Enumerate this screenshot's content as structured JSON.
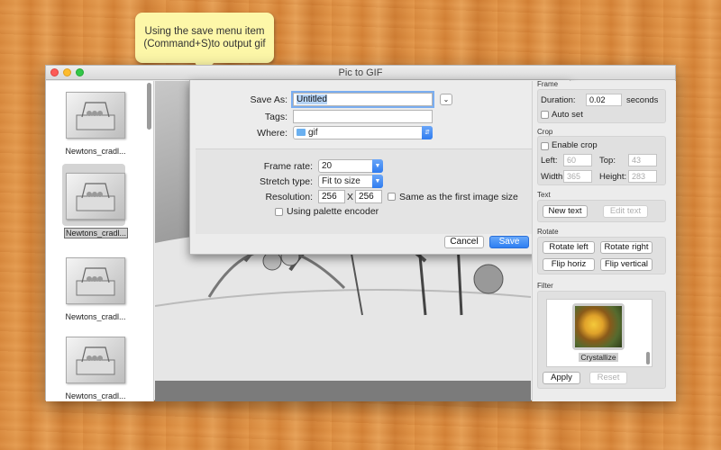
{
  "callout": {
    "line1": "Using the save menu item",
    "line2": "(Command+S)to output gif"
  },
  "window": {
    "title": "Pic to GIF"
  },
  "thumbnails": [
    {
      "label": "Newtons_cradl..."
    },
    {
      "label": "Newtons_cradl...",
      "selected": true
    },
    {
      "label": "Newtons_cradl..."
    },
    {
      "label": "Newtons_cradl..."
    }
  ],
  "save_sheet": {
    "save_as_label": "Save As:",
    "save_as_value": "Untitled",
    "tags_label": "Tags:",
    "tags_value": "",
    "where_label": "Where:",
    "where_value": "gif",
    "frame_rate_label": "Frame rate:",
    "frame_rate_value": "20",
    "stretch_label": "Stretch type:",
    "stretch_value": "Fit to size",
    "resolution_label": "Resolution:",
    "res_width": "256",
    "res_x": "X",
    "res_height": "256",
    "same_size_label": "Same as the first image size",
    "palette_label": "Using palette encoder",
    "cancel_label": "Cancel",
    "save_label": "Save"
  },
  "panel": {
    "frame": {
      "title": "Frame",
      "duration_label": "Duration:",
      "duration_value": "0.02",
      "seconds_label": "seconds",
      "autoset_label": "Auto set"
    },
    "crop": {
      "title": "Crop",
      "enable_label": "Enable crop",
      "left_label": "Left:",
      "left_value": "60",
      "top_label": "Top:",
      "top_value": "43",
      "width_label": "Width:",
      "width_value": "365",
      "height_label": "Height:",
      "height_value": "283"
    },
    "text": {
      "title": "Text",
      "new_label": "New text",
      "edit_label": "Edit text"
    },
    "rotate": {
      "title": "Rotate",
      "rotate_left": "Rotate left",
      "rotate_right": "Rotate right",
      "flip_horiz": "Flip horiz",
      "flip_vertical": "Flip vertical"
    },
    "filter": {
      "title": "Filter",
      "selected_filter": "Crystallize",
      "apply_label": "Apply",
      "reset_label": "Reset"
    }
  },
  "colors": {
    "accent": "#2f7ff2",
    "callout": "#fdf7a8"
  }
}
